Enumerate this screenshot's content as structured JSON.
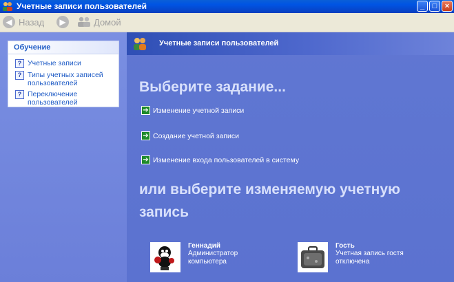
{
  "window": {
    "title": "Учетные записи пользователей"
  },
  "toolbar": {
    "back_label": "Назад",
    "home_label": "Домой"
  },
  "learn": {
    "heading": "Обучение",
    "items": [
      {
        "label": "Учетные записи"
      },
      {
        "label": "Типы учетных записей пользователей"
      },
      {
        "label": "Переключение пользователей"
      }
    ]
  },
  "main": {
    "header_title": "Учетные записи пользователей",
    "pick_task": "Выберите задание...",
    "tasks": [
      {
        "label": "Изменение учетной записи"
      },
      {
        "label": "Создание учетной записи"
      },
      {
        "label": "Изменение входа пользователей в систему"
      }
    ],
    "or_pick_account_line1": "или выберите изменяемую учетную",
    "or_pick_account_line2": "запись",
    "accounts": [
      {
        "name": "Геннадий",
        "description": "Администратор компьютера",
        "icon": "cartoon-cat-avatar-icon"
      },
      {
        "name": "Гость",
        "description": "Учетная запись гостя отключена",
        "icon": "suitcase-avatar-icon"
      }
    ]
  },
  "colors": {
    "title_bar": "#0054e3",
    "left_pane": "#7a8fe2",
    "right_pane": "#5b72d0",
    "task_arrow": "#1e8a2a"
  }
}
